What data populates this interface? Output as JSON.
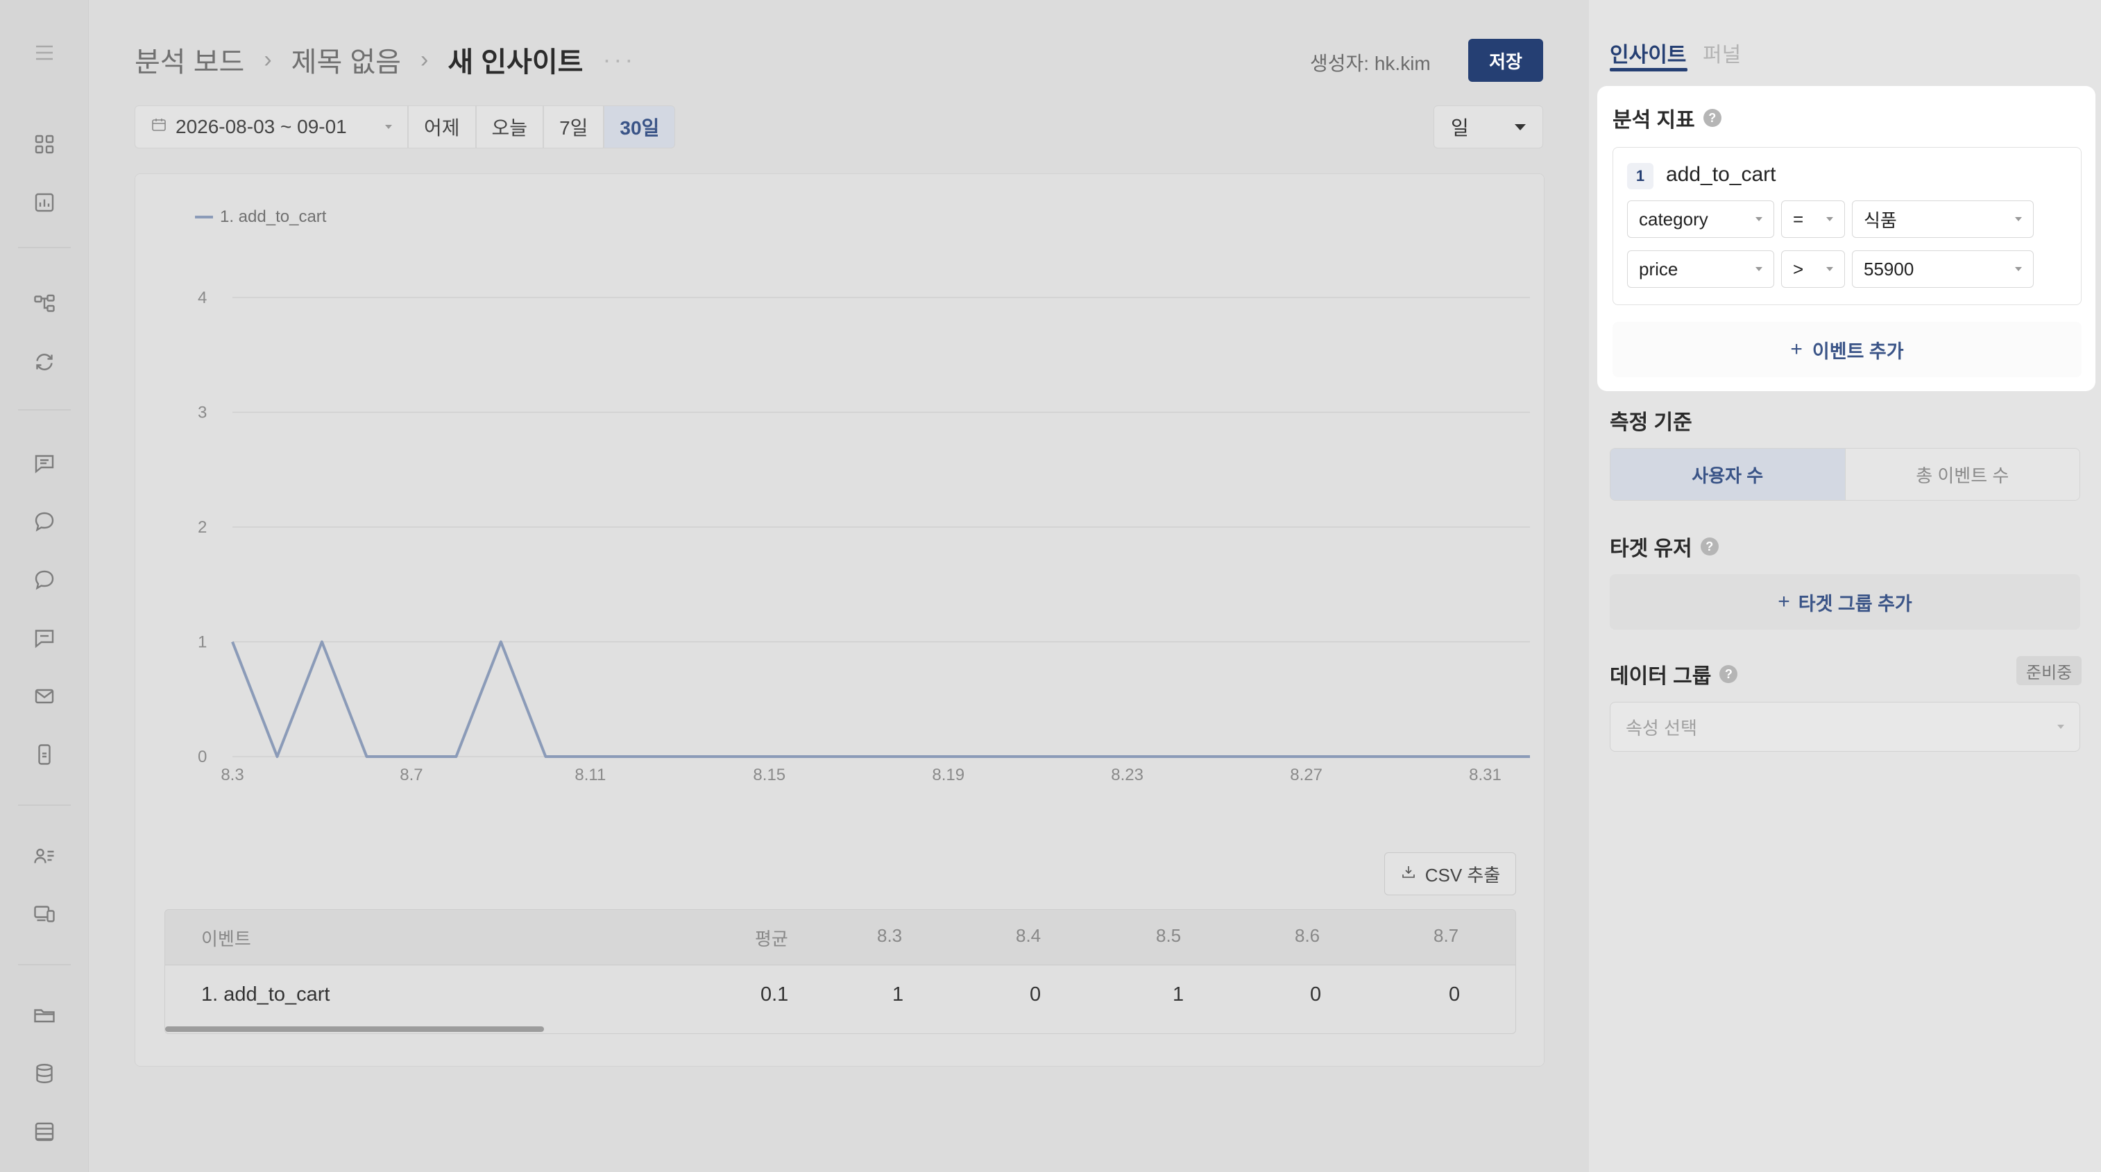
{
  "header": {
    "breadcrumb": [
      "분석 보드",
      "제목 없음",
      "새 인사이트"
    ],
    "more": "···",
    "creator": "생성자: hk.kim",
    "save_label": "저장"
  },
  "date_bar": {
    "range": "2026-08-03 ~ 09-01",
    "presets": [
      "어제",
      "오늘",
      "7일",
      "30일"
    ],
    "active_preset": "30일",
    "granularity": "일"
  },
  "chart_data": {
    "type": "line",
    "series": [
      {
        "name": "1. add_to_cart",
        "color": "#8b9bb8",
        "values": [
          1,
          0,
          1,
          0,
          0,
          0,
          1,
          0,
          0,
          0,
          0,
          0,
          0,
          0,
          0,
          0,
          0,
          0,
          0,
          0,
          0,
          0,
          0,
          0,
          0,
          0,
          0,
          0,
          0,
          0
        ]
      }
    ],
    "x_tick_labels": [
      "8.3",
      "8.7",
      "8.11",
      "8.15",
      "8.19",
      "8.23",
      "8.27",
      "8.31"
    ],
    "y_ticks": [
      0,
      1,
      2,
      3,
      4
    ],
    "ylim": [
      0,
      4
    ],
    "grid": true,
    "legend_position": "top-left"
  },
  "csv_label": "CSV 추출",
  "table": {
    "headers": [
      "이벤트",
      "평균",
      "8.3",
      "8.4",
      "8.5",
      "8.6",
      "8.7"
    ],
    "rows": [
      [
        "1. add_to_cart",
        "0.1",
        "1",
        "0",
        "1",
        "0",
        "0"
      ]
    ]
  },
  "right_panel": {
    "tabs": [
      "인사이트",
      "퍼널"
    ],
    "metric_title": "분석 지표",
    "event": {
      "number": "1",
      "name": "add_to_cart",
      "filters": [
        {
          "property": "category",
          "operator": "=",
          "value": "식품"
        },
        {
          "property": "price",
          "operator": ">",
          "value": "55900"
        }
      ]
    },
    "add_event_label": "이벤트 추가",
    "measure_title": "측정 기준",
    "measure_options": [
      "사용자 수",
      "총 이벤트 수"
    ],
    "target_title": "타겟 유저",
    "add_target_label": "타겟 그룹 추가",
    "data_group_title": "데이터 그룹",
    "data_group_badge": "준비중",
    "property_placeholder": "속성 선택"
  },
  "colors": {
    "accent": "#253f73",
    "accent_light": "#3a5487",
    "line": "#8b9bb8"
  }
}
